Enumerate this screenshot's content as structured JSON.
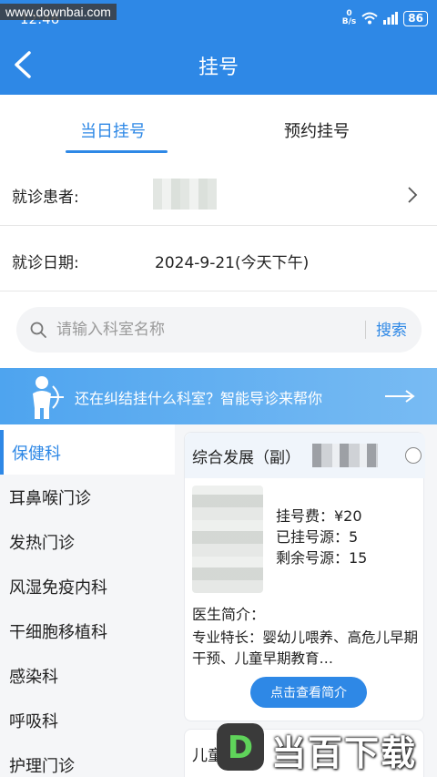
{
  "status": {
    "watermark": "www.downbai.com",
    "time": "12:46",
    "speed": "0",
    "speed_unit": "B/s",
    "battery": "86"
  },
  "header": {
    "title": "挂号"
  },
  "tabs": [
    {
      "label": "当日挂号",
      "active": true
    },
    {
      "label": "预约挂号",
      "active": false
    }
  ],
  "patient": {
    "label": "就诊患者:"
  },
  "visit_date": {
    "label": "就诊日期:",
    "value": "2024-9-21(今天下午)"
  },
  "search": {
    "placeholder": "请输入科室名称",
    "button": "搜索"
  },
  "banner": {
    "text": "还在纠结挂什么科室？智能导诊来帮你"
  },
  "departments": [
    {
      "label": "保健科",
      "active": true
    },
    {
      "label": "耳鼻喉门诊"
    },
    {
      "label": "发热门诊"
    },
    {
      "label": "风湿免疫内科"
    },
    {
      "label": "干细胞移植科"
    },
    {
      "label": "感染科"
    },
    {
      "label": "呼吸科"
    },
    {
      "label": "护理门诊"
    }
  ],
  "doctor_card": {
    "title": "综合发展（副）",
    "fee": "挂号费：¥20",
    "registered": "已挂号源：5",
    "remaining": "剩余号源：15",
    "intro_label": "医生简介：",
    "specialty": "专业特长：婴幼儿喂养、高危儿早期干预、儿童早期教育…",
    "button": "点击查看简介"
  },
  "doctor_card_2": {
    "title": "儿童"
  },
  "brand": {
    "text": "当百下载",
    "badge_letter": "D"
  },
  "colors": {
    "primary": "#2e88e6",
    "list_bg": "#f5f6f8"
  }
}
